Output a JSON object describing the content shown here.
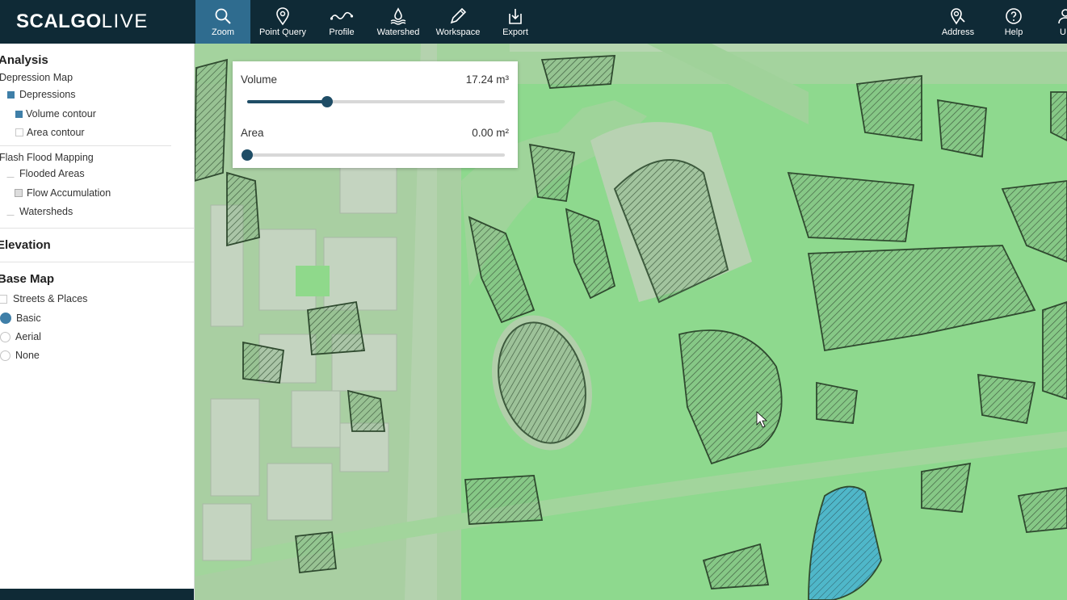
{
  "app": {
    "logo_bold": "SCALGO",
    "logo_light": "LIVE"
  },
  "toolbar": {
    "items": [
      {
        "label": "Zoom",
        "icon": "search-icon",
        "active": true
      },
      {
        "label": "Point Query",
        "icon": "map-pin-icon"
      },
      {
        "label": "Profile",
        "icon": "profile-line-icon"
      },
      {
        "label": "Watershed",
        "icon": "watershed-icon"
      },
      {
        "label": "Workspace",
        "icon": "pencil-icon"
      },
      {
        "label": "Export",
        "icon": "export-icon"
      }
    ],
    "right": [
      {
        "label": "Address",
        "icon": "address-search-icon"
      },
      {
        "label": "Help",
        "icon": "help-icon"
      },
      {
        "label": "U",
        "icon": "user-icon"
      }
    ]
  },
  "sidebar": {
    "analysis_title": "Analysis",
    "depression_map": "Depression Map",
    "depressions": "Depressions",
    "volume_contour": "Volume contour",
    "area_contour": "Area contour",
    "flash_flood": "Flash Flood Mapping",
    "flooded_areas": "Flooded Areas",
    "flow_accumulation": "Flow Accumulation",
    "watersheds": "Watersheds",
    "elevation_title": "Elevation",
    "base_map_title": "Base Map",
    "streets_places": "Streets & Places",
    "basemaps": [
      "Basic",
      "Aerial",
      "None"
    ],
    "selected_basemap": "Basic"
  },
  "sliders": {
    "volume": {
      "label": "Volume",
      "value": "17.24 m³",
      "fraction": 0.31
    },
    "area": {
      "label": "Area",
      "value": "0.00 m²",
      "fraction": 0.0
    }
  },
  "colors": {
    "topbar": "#0f2a36",
    "active_tool": "#2f6c8f",
    "accent": "#3f7fa8",
    "slider": "#1f4d66",
    "map_green": "#8ed98e",
    "water": "#4fb7c9"
  }
}
